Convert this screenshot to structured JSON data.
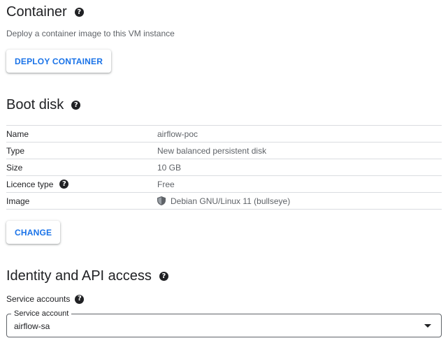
{
  "container": {
    "title": "Container",
    "help_glyph": "?",
    "description": "Deploy a container image to this VM instance",
    "deploy_button": "DEPLOY CONTAINER"
  },
  "boot_disk": {
    "title": "Boot disk",
    "rows": [
      {
        "label": "Name",
        "value": "airflow-poc"
      },
      {
        "label": "Type",
        "value": "New balanced persistent disk"
      },
      {
        "label": "Size",
        "value": "10 GB"
      },
      {
        "label": "Licence type",
        "value": "Free"
      },
      {
        "label": "Image",
        "value": "Debian GNU/Linux 11 (bullseye)"
      }
    ],
    "change_button": "CHANGE"
  },
  "identity": {
    "title": "Identity and API access",
    "service_accounts_label": "Service accounts",
    "service_account_field": {
      "legend": "Service account",
      "value": "airflow-sa"
    }
  },
  "colors": {
    "accent": "#1a73e8",
    "text_primary": "#202124",
    "text_secondary": "#5f6368",
    "divider": "#dadce0"
  }
}
